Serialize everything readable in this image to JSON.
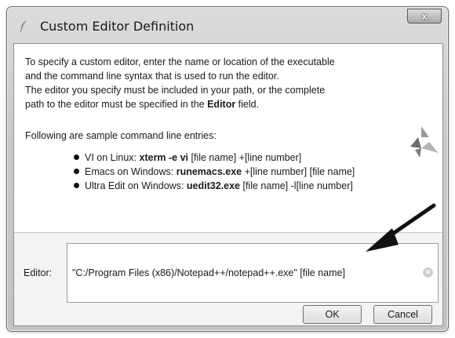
{
  "window": {
    "title": "Custom Editor Definition",
    "close_label": "x"
  },
  "intro": {
    "line1": "To specify a custom editor, enter the name or location of the executable",
    "line2": "and the command line syntax that is used to run the editor.",
    "line3": "The editor you specify must be included in your path, or the complete",
    "line4_prefix": "path to the editor must be specified in the ",
    "line4_bold": "Editor",
    "line4_suffix": " field."
  },
  "samples": {
    "heading": "Following are sample command line entries:",
    "items": [
      {
        "prefix": "VI on Linux: ",
        "command": "xterm -e vi",
        "args": " [file name] +[line number]"
      },
      {
        "prefix": "Emacs on Windows: ",
        "command": "runemacs.exe",
        "args": " +[line number] [file name]"
      },
      {
        "prefix": "Ultra Edit on Windows: ",
        "command": "uedit32.exe",
        "args": " [file name] -l[line number]"
      }
    ]
  },
  "editor": {
    "label": "Editor:",
    "value": "\"C:/Program Files (x86)/Notepad++/notepad++.exe\" [file name]"
  },
  "buttons": {
    "ok": "OK",
    "cancel": "Cancel"
  },
  "icons": {
    "title": "feather-icon",
    "logo": "app-logo-icon",
    "clear": "clear-icon",
    "annotation": "arrow-annotation"
  }
}
